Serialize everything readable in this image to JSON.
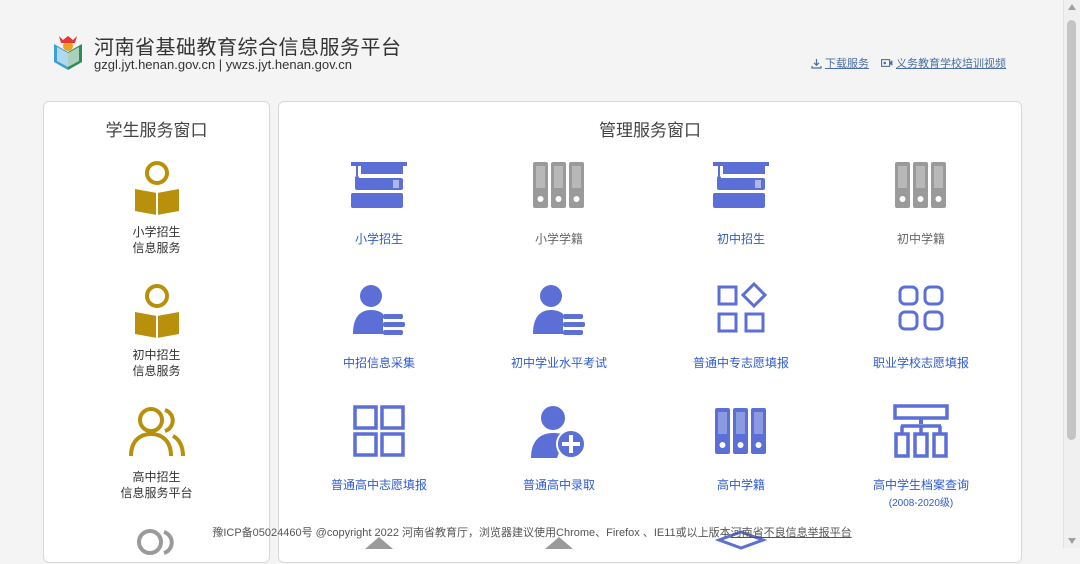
{
  "header": {
    "title": "河南省基础教育综合信息服务平台",
    "domains": "gzgl.jyt.henan.gov.cn | ywzs.jyt.henan.gov.cn",
    "links": [
      {
        "label": "下载服务",
        "icon": "download-icon"
      },
      {
        "label": "义务教育学校培训视频",
        "icon": "video-icon"
      }
    ]
  },
  "student_panel": {
    "title": "学生服务窗口",
    "items": [
      {
        "line1": "小学招生",
        "line2": "信息服务",
        "icon": "reader-icon"
      },
      {
        "line1": "初中招生",
        "line2": "信息服务",
        "icon": "reader-icon"
      },
      {
        "line1": "高中招生",
        "line2": "信息服务平台",
        "icon": "users-icon"
      }
    ]
  },
  "management_panel": {
    "title": "管理服务窗口",
    "items": [
      {
        "label": "小学招生",
        "icon": "books-graduation-icon",
        "active": true
      },
      {
        "label": "小学学籍",
        "icon": "binders-icon",
        "active": false
      },
      {
        "label": "初中招生",
        "icon": "books-graduation-icon",
        "active": true
      },
      {
        "label": "初中学籍",
        "icon": "binders-icon",
        "active": false
      },
      {
        "label": "中招信息采集",
        "icon": "user-list-icon",
        "active": true
      },
      {
        "label": "初中学业水平考试",
        "icon": "user-list-icon",
        "active": true
      },
      {
        "label": "普通中专志愿填报",
        "icon": "apps-diamond-icon",
        "active": true
      },
      {
        "label": "职业学校志愿填报",
        "icon": "grid-rounded-icon",
        "active": true
      },
      {
        "label": "普通高中志愿填报",
        "icon": "grid-squares-icon",
        "active": true
      },
      {
        "label": "普通高中录取",
        "icon": "user-add-icon",
        "active": true
      },
      {
        "label": "高中学籍",
        "icon": "binders-icon",
        "active": true
      },
      {
        "label": "高中学生档案查询",
        "sub": "(2008-2020级)",
        "icon": "org-chart-icon",
        "active": true
      }
    ]
  },
  "footer": {
    "text": "豫ICP备05024460号 @copyright 2022 河南省教育厅，浏览器建议使用Chrome、Firefox 、IE11或以上版本",
    "report_link": "河南省不良信息举报平台"
  },
  "colors": {
    "icon_active": "#5b6fd6",
    "icon_inactive": "#9a9a9a",
    "gold": "#b8900c"
  }
}
